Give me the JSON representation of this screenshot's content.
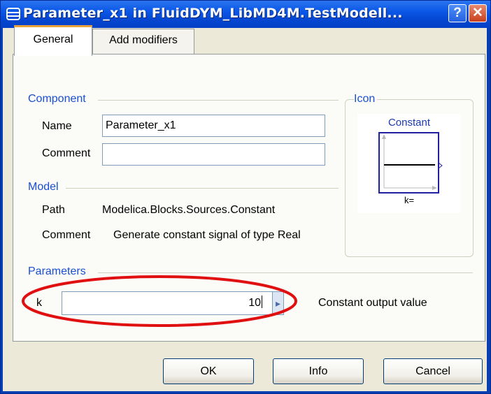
{
  "window": {
    "title": "Parameter_x1 in FluidDYM_LibMD4M.TestModell...",
    "help_label": "?",
    "close_label": "✕"
  },
  "tabs": [
    {
      "label": "General",
      "active": true
    },
    {
      "label": "Add modifiers",
      "active": false
    }
  ],
  "component": {
    "group_title": "Component",
    "name_label": "Name",
    "name_value": "Parameter_x1",
    "comment_label": "Comment",
    "comment_value": ""
  },
  "icon": {
    "group_title": "Icon",
    "block_title": "Constant",
    "block_caption": "k="
  },
  "model": {
    "group_title": "Model",
    "path_label": "Path",
    "path_value": "Modelica.Blocks.Sources.Constant",
    "comment_label": "Comment",
    "comment_value": "Generate constant signal of type Real"
  },
  "parameters": {
    "group_title": "Parameters",
    "k_label": "k",
    "k_value": "10",
    "k_description": "Constant output value"
  },
  "buttons": {
    "ok": "OK",
    "info": "Info",
    "cancel": "Cancel"
  },
  "colors": {
    "highlight_ellipse": "#e01010",
    "group_title": "#1a4fd1",
    "titlebar": "#0a56e6"
  }
}
